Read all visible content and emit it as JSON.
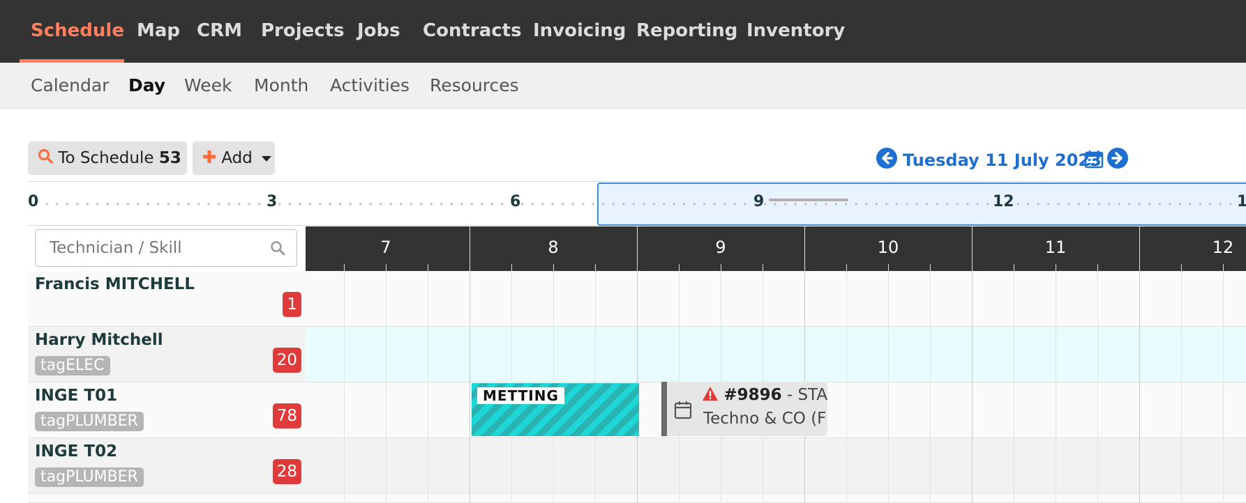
{
  "top_nav": {
    "items": [
      "Schedule",
      "Map",
      "CRM",
      "Projects",
      "Jobs",
      "Contracts",
      "Invoicing",
      "Reporting",
      "Inventory"
    ],
    "active": "Schedule",
    "active_color": "#ff7f5e"
  },
  "sub_nav": {
    "items": [
      "Calendar",
      "Day",
      "Week",
      "Month",
      "Activities",
      "Resources"
    ],
    "active": "Day"
  },
  "toolbar": {
    "to_schedule_label": "To Schedule",
    "to_schedule_count": "53",
    "add_label": "Add",
    "date": "Tuesday 11 July 2023",
    "accent_color": "#1f6fd1"
  },
  "overview": {
    "labels": [
      "0",
      "3",
      "6",
      "9",
      "12",
      "1"
    ]
  },
  "search": {
    "placeholder": "Technician / Skill"
  },
  "grid": {
    "hours": [
      "7",
      "8",
      "9",
      "10",
      "11",
      "12"
    ]
  },
  "technicians": [
    {
      "name": "Francis MITCHELL",
      "tag": "",
      "count": "1"
    },
    {
      "name": "Harry Mitchell",
      "tag": "tagELEC",
      "count": "20"
    },
    {
      "name": "INGE T01",
      "tag": "tagPLUMBER",
      "count": "78"
    },
    {
      "name": "INGE T02",
      "tag": "tagPLUMBER",
      "count": "28"
    }
  ],
  "events": {
    "meeting_label": "METTING",
    "job_number": "#9896",
    "job_title_partial": " - STA",
    "job_client_partial": "Techno & CO (F"
  },
  "colors": {
    "badge": "#e03b3b",
    "highlight_row": "#e8fcfd",
    "meeting": "#1fd6d6"
  }
}
